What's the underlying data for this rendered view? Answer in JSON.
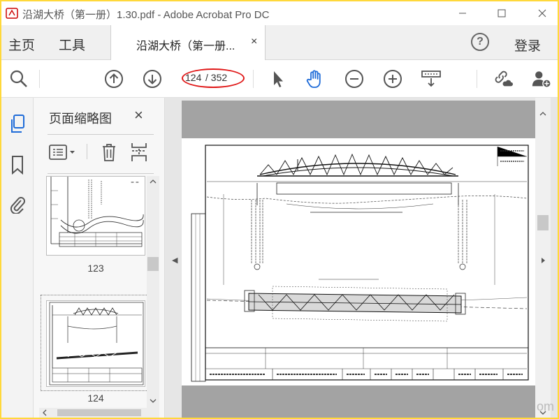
{
  "window": {
    "title": "沿湖大桥（第一册）1.30.pdf - Adobe Acrobat Pro DC"
  },
  "nav": {
    "home_label": "主页",
    "tools_label": "工具",
    "doc_tab_label": "沿湖大桥（第一册...",
    "doc_tab_close": "×",
    "help_label": "?",
    "login_label": "登录"
  },
  "toolbar": {
    "current_page": "124",
    "total_pages": "/ 352",
    "icons": [
      "zoom-search-icon",
      "previous-page-icon",
      "next-page-icon",
      "select-cursor-icon",
      "hand-tool-icon",
      "zoom-out-icon",
      "zoom-in-icon",
      "page-display-icon",
      "share-link-icon",
      "add-user-icon"
    ],
    "accent_color": "#1e6bd8",
    "highlight_color": "#e01818"
  },
  "thumbnails_panel": {
    "title": "页面缩略图",
    "close_label": "×",
    "thumbnails": [
      {
        "page_label": "123"
      },
      {
        "page_label": "124"
      }
    ]
  },
  "watermark": "om"
}
